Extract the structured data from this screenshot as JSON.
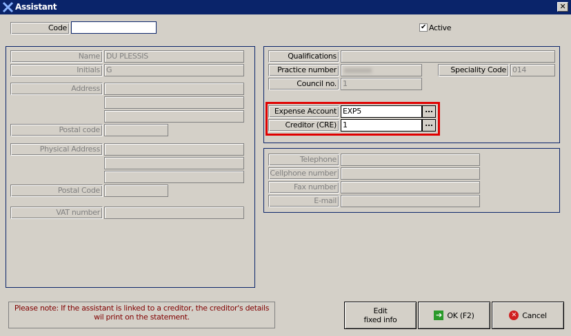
{
  "window": {
    "title": "Assistant",
    "close": "✕"
  },
  "code": {
    "label": "Code",
    "value": ""
  },
  "active": {
    "label": "Active",
    "checked": true
  },
  "personal": {
    "name": {
      "label": "Name",
      "value": "DU PLESSIS"
    },
    "initials": {
      "label": "Initials",
      "value": "G"
    },
    "address": {
      "label": "Address"
    },
    "postal_code": {
      "label": "Postal code"
    },
    "physical_address": {
      "label": "Physical Address"
    },
    "physical_postal_code": {
      "label": "Postal Code"
    },
    "vat": {
      "label": "VAT number"
    }
  },
  "practice": {
    "qualifications": {
      "label": "Qualifications",
      "value": ""
    },
    "practice_number": {
      "label": "Practice number"
    },
    "speciality": {
      "label": "Speciality Code",
      "value": "014"
    },
    "council": {
      "label": "Council no.",
      "value": "1"
    },
    "expense": {
      "label": "Expense Account",
      "value": "EXP5"
    },
    "creditor": {
      "label": "Creditor (CRE)",
      "value": "1"
    },
    "lookup": "..."
  },
  "contact": {
    "telephone": "Telephone",
    "cellphone": "Cellphone number",
    "fax": "Fax number",
    "email": "E-mail"
  },
  "note": "Please note: If the assistant is linked to a creditor, the creditor's details wil print on the statement.",
  "buttons": {
    "edit": "Edit\nfixed info",
    "ok": "OK (F2)",
    "cancel": "Cancel"
  }
}
